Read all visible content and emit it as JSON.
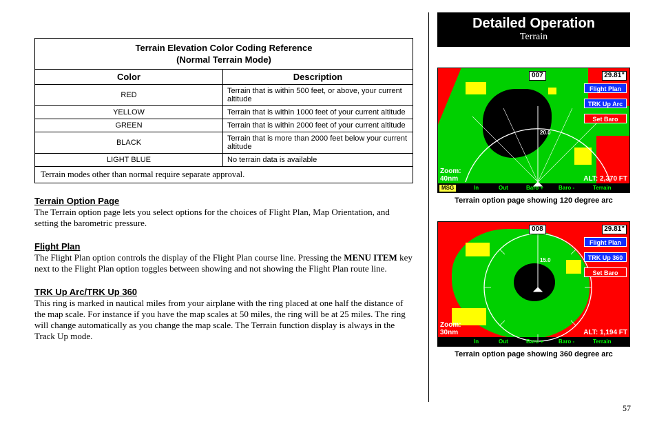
{
  "header": {
    "title": "Detailed Operation",
    "subtitle": "Terrain"
  },
  "table": {
    "title_l1": "Terrain Elevation Color Coding Reference",
    "title_l2": "(Normal Terrain Mode)",
    "col_color": "Color",
    "col_desc": "Description",
    "rows": [
      {
        "color": "RED",
        "desc": "Terrain that is within 500 feet, or above, your current altitude"
      },
      {
        "color": "YELLOW",
        "desc": "Terrain that is within 1000 feet of your current altitude"
      },
      {
        "color": "GREEN",
        "desc": "Terrain that is within 2000 feet of your current altitude"
      },
      {
        "color": "BLACK",
        "desc": "Terrain that is more than 2000 feet below your current altitude"
      },
      {
        "color": "LIGHT BLUE",
        "desc": "No terrain data is available"
      }
    ],
    "footnote": "Terrain modes other than normal require separate approval."
  },
  "sections": {
    "s1": {
      "heading": "Terrain Option Page",
      "body": "The Terrain option page lets you select options for the choices of Flight Plan, Map Orientation, and setting the barometric pressure."
    },
    "s2": {
      "heading": "Flight Plan",
      "body_a": "The Flight Plan option controls the display of the Flight Plan course line. Pressing the ",
      "body_bold": "MENU ITEM",
      "body_b": " key next to the Flight Plan option toggles between showing and not showing the Flight Plan route line."
    },
    "s3": {
      "heading": "TRK Up Arc/TRK Up 360",
      "body": "This ring is marked in nautical miles from your airplane with the ring placed at one half the distance of the map scale. For instance if you have the map scales at 50 miles, the ring will be at 25 miles. The ring will change automatically as you change the map scale. The Terrain function display is always in the Track Up mode."
    }
  },
  "figures": {
    "f1": {
      "caption": "Terrain option page showing 120 degree arc",
      "hdg": "007",
      "baro": "29.81\"",
      "btn1": "Flight Plan",
      "btn2": "TRK Up Arc",
      "btn3": "Set Baro",
      "zoom_l1": "Zoom:",
      "zoom_l2": "40nm",
      "alt": "ALT:  2,370 FT",
      "msg": "MSG",
      "soft_in": "In",
      "soft_out": "Out",
      "soft_bp": "Baro +",
      "soft_bm": "Baro -",
      "soft_terr": "Terrain",
      "wpt": "20.0"
    },
    "f2": {
      "caption": "Terrain option page showing 360 degree arc",
      "hdg": "008",
      "baro": "29.81\"",
      "btn1": "Flight Plan",
      "btn2": "TRK Up 360",
      "btn3": "Set Baro",
      "zoom_l1": "Zoom:",
      "zoom_l2": "30nm",
      "alt": "ALT:  1,194 FT",
      "soft_in": "In",
      "soft_out": "Out",
      "soft_bp": "Baro +",
      "soft_bm": "Baro -",
      "soft_terr": "Terrain",
      "wpt": "15.0"
    }
  },
  "page_number": "57"
}
